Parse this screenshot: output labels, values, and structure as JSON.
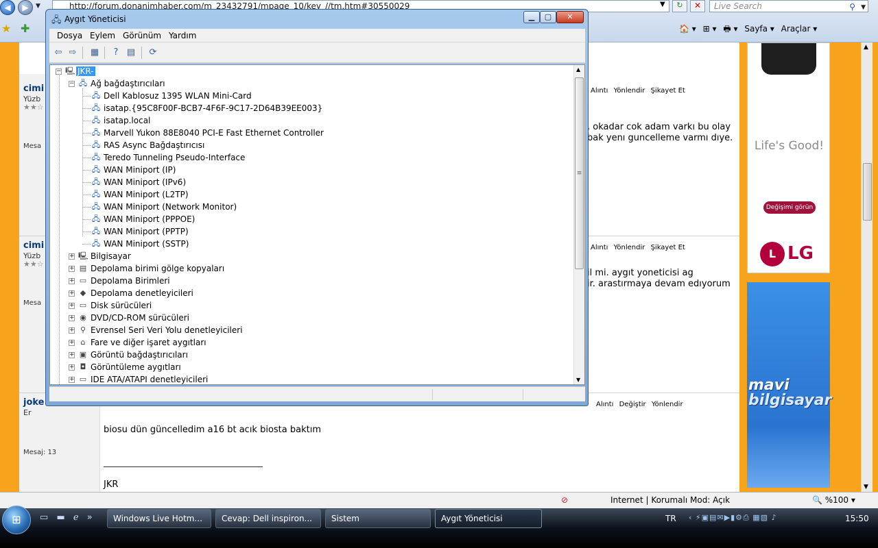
{
  "ie": {
    "address": "http://forum.donanimhaber.com/m_23432791/mpage_10/key_//tm.htm#30550029",
    "search_placeholder": "Live Search",
    "cmd": {
      "home": "🏠 ▾",
      "feeds": "⊞ ▾",
      "print": "🖶 ▾",
      "page": "Sayfa ▾",
      "tools": "Araçlar ▾"
    }
  },
  "posts": [
    {
      "user": "cimi",
      "rank": "Yüzb",
      "stars": "★★☆",
      "mesaj": "Mesa",
      "actions": [
        "Alıntı",
        "Yönlendir",
        "Şikayet Et"
      ],
      "text": [
        ". okadar cok adam varkı bu olay",
        "bak yenı guncelleme varmı dıye."
      ]
    },
    {
      "user": "cimi",
      "rank": "Yüzb",
      "stars": "★★☆",
      "mesaj": "Mesa",
      "actions": [
        "Alıntı",
        "Yönlendir",
        "Şikayet Et"
      ],
      "text": [
        "il mi. aygıt yoneticisi ag",
        "ir. arastırmaya devam edıyorum"
      ]
    },
    {
      "user": "joke",
      "rank": "Er",
      "mesaj": "Mesaj: 13",
      "actions": [
        "Alıntı",
        "Değiştir",
        "Yönlendir"
      ],
      "text": [
        "biosu dün güncelledim a16 bt acık biosta baktım"
      ],
      "signature": "JKR"
    }
  ],
  "ads": {
    "lifes_good": "Life's Good!",
    "cta": "Değişimi görün",
    "lg_mark": "L",
    "lg_brand": "LG",
    "mavi_line1": "mavi",
    "mavi_line2": "bilgisayar"
  },
  "statusbar": {
    "zone": "Internet | Korumalı Mod: Açık",
    "zoom": "🔍 %100 ▾"
  },
  "taskbar": {
    "items": [
      "Windows Live Hotm...",
      "Cevap: Dell inspiron...",
      "Sistem",
      "Aygıt Yöneticisi"
    ],
    "lang": "TR",
    "clock": "15:50"
  },
  "devmgr": {
    "title": "Aygıt Yöneticisi",
    "menu": [
      "Dosya",
      "Eylem",
      "Görünüm",
      "Yardım"
    ],
    "root": "JKR-",
    "network_group": "Ağ bağdaştırıcıları",
    "network_devices": [
      "Dell Kablosuz 1395 WLAN Mini-Card",
      "isatap.{95C8F00F-BCB7-4F6F-9C17-2D64B39EE003}",
      "isatap.local",
      "Marvell Yukon 88E8040 PCI-E Fast Ethernet Controller",
      "RAS Async Bağdaştırıcısı",
      "Teredo Tunneling Pseudo-Interface",
      "WAN Miniport (IP)",
      "WAN Miniport (IPv6)",
      "WAN Miniport (L2TP)",
      "WAN Miniport (Network Monitor)",
      "WAN Miniport (PPPOE)",
      "WAN Miniport (PPTP)",
      "WAN Miniport (SSTP)"
    ],
    "categories": [
      {
        "label": "Bilgisayar",
        "icon": "computer-icon"
      },
      {
        "label": "Depolama birimi gölge kopyaları",
        "icon": "storage-icon"
      },
      {
        "label": "Depolama Birimleri",
        "icon": "drive-icon"
      },
      {
        "label": "Depolama denetleyicileri",
        "icon": "controller-icon"
      },
      {
        "label": "Disk sürücüleri",
        "icon": "disk-icon"
      },
      {
        "label": "DVD/CD-ROM sürücüleri",
        "icon": "dvd-icon"
      },
      {
        "label": "Evrensel Seri Veri Yolu denetleyicileri",
        "icon": "usb-icon"
      },
      {
        "label": "Fare ve diğer işaret aygıtları",
        "icon": "mouse-icon"
      },
      {
        "label": "Görüntü bağdaştırıcıları",
        "icon": "display-icon"
      },
      {
        "label": "Görüntüleme aygıtları",
        "icon": "camera-icon"
      },
      {
        "label": "IDE ATA/ATAPI denetleyicileri",
        "icon": "ide-icon"
      }
    ]
  }
}
